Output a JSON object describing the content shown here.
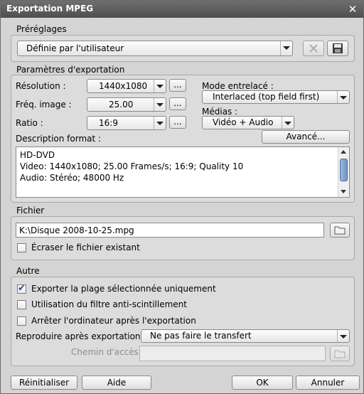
{
  "window": {
    "title": "Exportation MPEG",
    "close_glyph": "✕"
  },
  "presets": {
    "section_label": "Préréglages",
    "selected": "Définie par l'utilisateur",
    "delete_icon": "delete-icon",
    "save_icon": "save-icon"
  },
  "export_params": {
    "section_label": "Paramètres d'exportation",
    "resolution_label": "Résolution :",
    "resolution_value": "1440x1080",
    "framerate_label": "Fréq. image :",
    "framerate_value": "25.00",
    "ratio_label": "Ratio :",
    "ratio_value": "16:9",
    "more_label": "...",
    "interlace_label": "Mode entrelacé :",
    "interlace_value": "Interlaced (top field first)",
    "media_label": "Médias :",
    "media_value": "Vidéo + Audio",
    "advanced_label": "Avancé...",
    "description_label": "Description format :",
    "description_lines": [
      "HD-DVD",
      "Video: 1440x1080; 25.00 Frames/s; 16:9; Quality 10",
      "Audio: Stéréo; 48000 Hz"
    ]
  },
  "file": {
    "section_label": "Fichier",
    "path": "K:\\Disque 2008-10-25.mpg",
    "overwrite_label": "Écraser le fichier existant",
    "overwrite_checked": false
  },
  "other": {
    "section_label": "Autre",
    "options": [
      {
        "label": "Exporter la plage sélectionnée uniquement",
        "checked": true
      },
      {
        "label": "Utilisation du filtre anti-scintillement",
        "checked": false
      },
      {
        "label": "Arrêter l'ordinateur après l'exportation",
        "checked": false
      }
    ],
    "play_after_label": "Reproduire après exportation :",
    "play_after_value": "Ne pas faire le transfert",
    "path_label": "Chemin d'accès :",
    "path_value": ""
  },
  "footer": {
    "reset_label": "Réinitialiser",
    "help_label": "Aide",
    "ok_label": "OK",
    "cancel_label": "Annuler"
  },
  "colors": {
    "titlebar": "#5a5a5a",
    "dialog_bg": "#d4d4d4",
    "checkmark": "#1a4f9c",
    "scroll_thumb": "#6e93c6"
  }
}
